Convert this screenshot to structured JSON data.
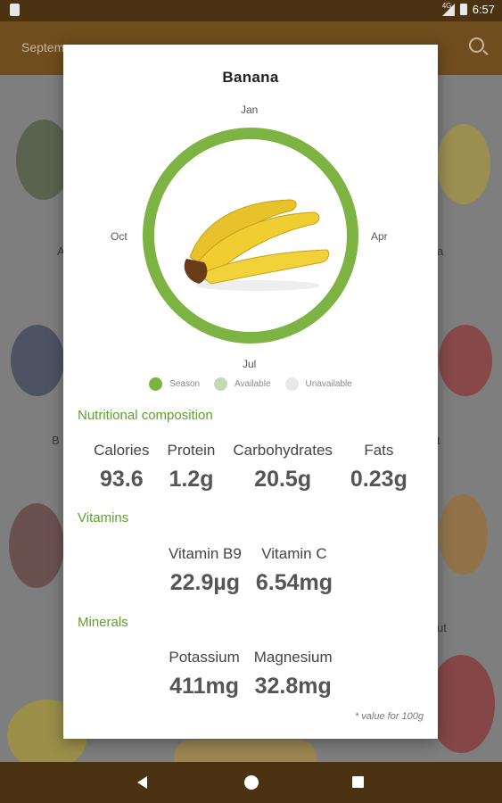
{
  "status_bar": {
    "network": "4G",
    "time": "6:57"
  },
  "app_bar": {
    "title": "Septem"
  },
  "background": {
    "labels": [
      "A",
      "a",
      "B",
      "t",
      "ut"
    ]
  },
  "dialog": {
    "title": "Banana",
    "months": {
      "top": "Jan",
      "right": "Apr",
      "bottom": "Jul",
      "left": "Oct"
    },
    "legend": [
      {
        "label": "Season",
        "color": "#7cb342"
      },
      {
        "label": "Available",
        "color": "#c5d9b4"
      },
      {
        "label": "Unavailable",
        "color": "#e8e8e8"
      }
    ],
    "nutritional": {
      "heading": "Nutritional composition",
      "items": [
        {
          "label": "Calories",
          "value": "93.6"
        },
        {
          "label": "Protein",
          "value": "1.2g"
        },
        {
          "label": "Carbohydrates",
          "value": "20.5g"
        },
        {
          "label": "Fats",
          "value": "0.23g"
        }
      ]
    },
    "vitamins": {
      "heading": "Vitamins",
      "items": [
        {
          "label": "Vitamin B9",
          "value": "22.9µg"
        },
        {
          "label": "Vitamin C",
          "value": "6.54mg"
        }
      ]
    },
    "minerals": {
      "heading": "Minerals",
      "items": [
        {
          "label": "Potassium",
          "value": "411mg"
        },
        {
          "label": "Magnesium",
          "value": "32.8mg"
        }
      ]
    },
    "footnote": "* value for 100g"
  }
}
